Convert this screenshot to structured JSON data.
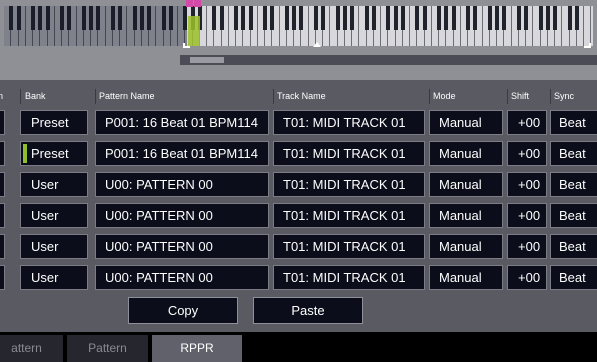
{
  "headers": {
    "bank": "Bank",
    "pattern_name": "Pattern Name",
    "track_name": "Track Name",
    "mode": "Mode",
    "shift": "Shift",
    "sync": "Sync",
    "edge": "n"
  },
  "rows": [
    {
      "bank": "Preset",
      "pattern": "P001: 16 Beat 01 BPM114",
      "track": "T01: MIDI TRACK 01",
      "mode": "Manual",
      "shift": "+00",
      "sync": "Beat",
      "selected": false
    },
    {
      "bank": "Preset",
      "pattern": "P001: 16 Beat 01 BPM114",
      "track": "T01: MIDI TRACK 01",
      "mode": "Manual",
      "shift": "+00",
      "sync": "Beat",
      "selected": true
    },
    {
      "bank": "User",
      "pattern": "U00: PATTERN 00",
      "track": "T01: MIDI TRACK 01",
      "mode": "Manual",
      "shift": "+00",
      "sync": "Beat",
      "selected": false
    },
    {
      "bank": "User",
      "pattern": "U00: PATTERN 00",
      "track": "T01: MIDI TRACK 01",
      "mode": "Manual",
      "shift": "+00",
      "sync": "Beat",
      "selected": false
    },
    {
      "bank": "User",
      "pattern": "U00: PATTERN 00",
      "track": "T01: MIDI TRACK 01",
      "mode": "Manual",
      "shift": "+00",
      "sync": "Beat",
      "selected": false
    },
    {
      "bank": "User",
      "pattern": "U00: PATTERN 00",
      "track": "T01: MIDI TRACK 01",
      "mode": "Manual",
      "shift": "+00",
      "sync": "Beat",
      "selected": false
    }
  ],
  "buttons": {
    "copy": "Copy",
    "paste": "Paste"
  },
  "tabs": {
    "tab1": "attern",
    "tab2": "Pattern",
    "tab3": "RPPR",
    "active": "RPPR"
  },
  "colors": {
    "selection_marker": "#8fbf2a",
    "key_marker": "#d24aa8",
    "cell_background": "#0b0d1a",
    "panel_background": "#5a5b62"
  }
}
